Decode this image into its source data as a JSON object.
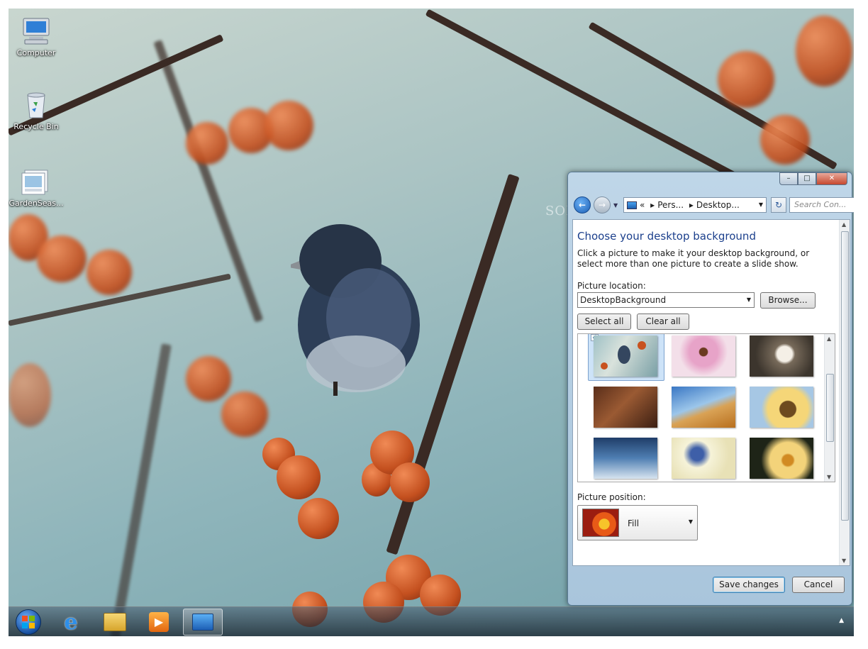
{
  "desktop": {
    "icons": [
      {
        "label": "Computer",
        "icon": "computer-icon"
      },
      {
        "label": "Recycle Bin",
        "icon": "recycle-bin-icon"
      },
      {
        "label": "GardenSeas...",
        "icon": "theme-pack-icon"
      }
    ],
    "watermark": "SOFTPEDIA"
  },
  "window": {
    "caption_buttons": {
      "minimize": "–",
      "maximize": "□",
      "close": "✕"
    },
    "nav": {
      "back_icon": "arrow-left-icon",
      "forward_icon": "arrow-right-icon",
      "breadcrumb": [
        "Pers...",
        "Desktop..."
      ],
      "breadcrumb_prefix": "«",
      "search_placeholder": "Search Con..."
    },
    "title": "Choose your desktop background",
    "instructions": "Click a picture to make it your desktop background, or select more than one picture to create a slide show.",
    "picture_location_label": "Picture location:",
    "picture_location_value": "DesktopBackground",
    "browse_label": "Browse...",
    "select_all_label": "Select all",
    "clear_all_label": "Clear all",
    "thumbnails": [
      {
        "name": "bird-berries",
        "selected": true
      },
      {
        "name": "pink-coneflowers",
        "selected": false
      },
      {
        "name": "white-blossoms",
        "selected": false
      },
      {
        "name": "wood-ladybug",
        "selected": false
      },
      {
        "name": "dry-leaf-sky",
        "selected": false
      },
      {
        "name": "sunflower",
        "selected": false
      },
      {
        "name": "frost-plant",
        "selected": false
      },
      {
        "name": "blue-flowers",
        "selected": false
      },
      {
        "name": "yellow-daisy",
        "selected": false
      }
    ],
    "picture_position_label": "Picture position:",
    "picture_position_value": "Fill",
    "save_label": "Save changes",
    "cancel_label": "Cancel"
  },
  "taskbar": {
    "items": [
      {
        "name": "start-orb",
        "active": false
      },
      {
        "name": "internet-explorer-icon",
        "active": false
      },
      {
        "name": "windows-explorer-icon",
        "active": false
      },
      {
        "name": "media-player-icon",
        "active": false
      },
      {
        "name": "control-panel-icon",
        "active": true
      }
    ],
    "tray_arrow": "▲"
  }
}
